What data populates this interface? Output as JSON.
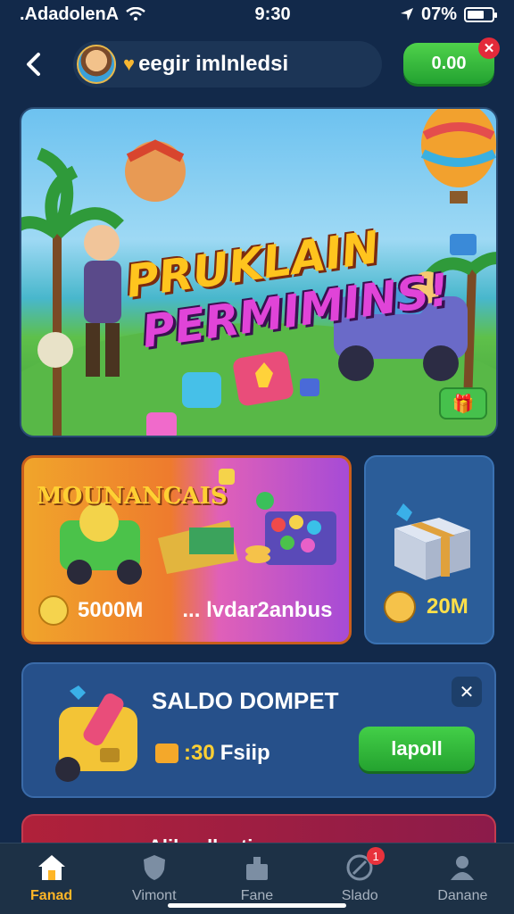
{
  "status_bar": {
    "carrier": ".AdadolenA",
    "time": "9:30",
    "battery": "07%",
    "battery_level": 0.7
  },
  "header": {
    "user_name": "eegir imlnledsi",
    "balance_label": "0.00",
    "balance_badge": "✕"
  },
  "hero": {
    "title_line1": "PRUKLAIN",
    "title_line2": "PERMIMINS!"
  },
  "promo_card": {
    "title": "MOUNANCAIS",
    "amount": "5000M",
    "subtitle": "... lvdar2anbus"
  },
  "gift_card": {
    "amount": "20M"
  },
  "wallet_card": {
    "title": "SALDO DOMPET",
    "amount": ":30",
    "amount_suffix": "Fsiip",
    "button_label": "lapoll",
    "close_icon": "✕"
  },
  "bottom_card": {
    "title": "Alika dlantinun"
  },
  "tab_bar": {
    "tabs": [
      {
        "label": "Fanad",
        "icon": "home-icon",
        "active": true
      },
      {
        "label": "Vimont",
        "icon": "shield-icon",
        "active": false
      },
      {
        "label": "Fane",
        "icon": "game-icon",
        "active": false
      },
      {
        "label": "Slado",
        "icon": "wallet-icon",
        "active": false,
        "badge": "1"
      },
      {
        "label": "Danane",
        "icon": "profile-icon",
        "active": false
      }
    ]
  },
  "colors": {
    "accent": "#ffb627",
    "green": "#43cf48",
    "background": "#12294a"
  }
}
